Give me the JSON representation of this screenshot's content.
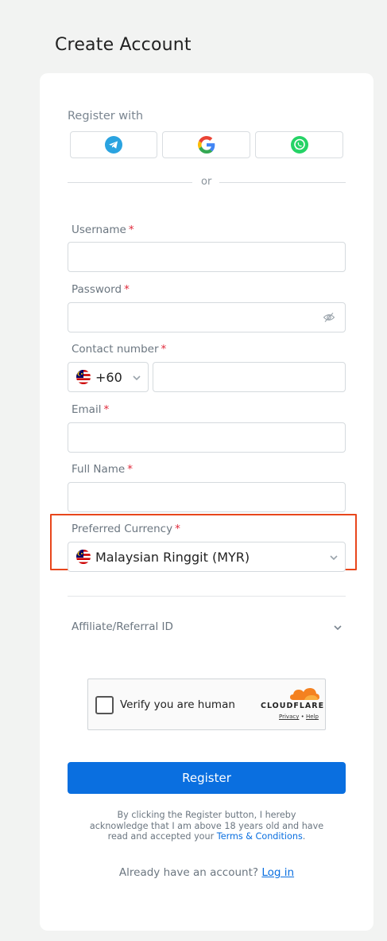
{
  "page": {
    "title": "Create Account"
  },
  "social": {
    "label": "Register with",
    "buttons": [
      {
        "name": "telegram",
        "icon": "telegram-icon",
        "color": "#2aa3e0"
      },
      {
        "name": "google",
        "icon": "google-icon"
      },
      {
        "name": "whatsapp",
        "icon": "whatsapp-icon",
        "color": "#25d366"
      }
    ],
    "or_label": "or"
  },
  "form": {
    "username": {
      "label": "Username",
      "required": "*",
      "value": ""
    },
    "password": {
      "label": "Password",
      "required": "*",
      "value": ""
    },
    "contact": {
      "label": "Contact number",
      "required": "*",
      "country_code": "+60",
      "value": ""
    },
    "email": {
      "label": "Email",
      "required": "*",
      "value": ""
    },
    "full_name": {
      "label": "Full Name",
      "required": "*",
      "value": ""
    },
    "currency": {
      "label": "Preferred Currency",
      "required": "*",
      "selected": "Malaysian Ringgit (MYR)"
    },
    "affiliate": {
      "label": "Affiliate/Referral ID"
    }
  },
  "captcha": {
    "label": "Verify you are human",
    "brand": "CLOUDFLARE",
    "privacy": "Privacy",
    "separator": "•",
    "help": "Help"
  },
  "register": {
    "button_label": "Register",
    "disclaimer_text": "By clicking the Register button, I hereby acknowledge that I am above 18 years old and have read and accepted your",
    "terms_link": "Terms & Conditions",
    "period": "."
  },
  "login": {
    "prompt": "Already have an account?",
    "link": "Log in"
  },
  "colors": {
    "primary": "#0a6fe0",
    "highlight": "#e8461c",
    "required": "#e0293a"
  }
}
